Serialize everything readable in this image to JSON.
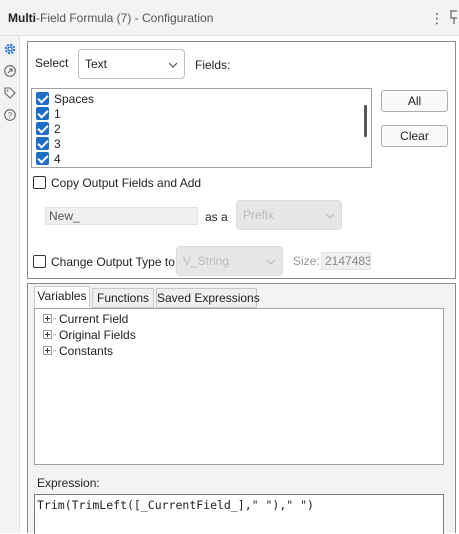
{
  "title": {
    "bold": "Multi",
    "rest": "-Field Formula (7) - Configuration"
  },
  "toolbar": {
    "menu_icon": "more-vertical-icon",
    "pin_icon": "pin-icon"
  },
  "left_sidebar": [
    {
      "name": "gear-icon"
    },
    {
      "name": "arrow-circle-icon"
    },
    {
      "name": "tag-icon"
    },
    {
      "name": "help-icon"
    }
  ],
  "config": {
    "select_label": "Select",
    "select_value": "Text",
    "fields_label": "Fields:",
    "fields": [
      {
        "label": "Spaces",
        "checked": true
      },
      {
        "label": "1",
        "checked": true
      },
      {
        "label": "2",
        "checked": true
      },
      {
        "label": "3",
        "checked": true
      },
      {
        "label": "4",
        "checked": true
      }
    ],
    "all_button": "All",
    "clear_button": "Clear",
    "copy_output_label": "Copy Output Fields and Add",
    "copy_output_checked": false,
    "name_value": "New_",
    "as_a_label": "as a",
    "prefix_value": "Prefix",
    "change_type_label": "Change Output Type to",
    "change_type_checked": false,
    "type_value": "V_String",
    "size_label": "Size:",
    "size_value": "2147483"
  },
  "tabs": [
    {
      "label": "Variables",
      "active": true
    },
    {
      "label": "Functions",
      "active": false
    },
    {
      "label": "Saved Expressions",
      "active": false
    }
  ],
  "tree": [
    {
      "label": "Current Field"
    },
    {
      "label": "Original Fields"
    },
    {
      "label": "Constants"
    }
  ],
  "expression": {
    "label": "Expression:",
    "value": "Trim(TrimLeft([_CurrentField_],\" \"),\" \")"
  },
  "colors": {
    "accent": "#1e6ec8",
    "border": "#8a8a8a",
    "panel_bg": "#f3f3f3"
  }
}
